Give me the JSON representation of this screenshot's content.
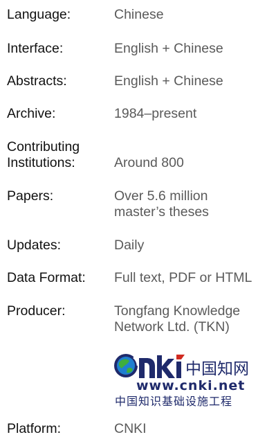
{
  "rows": [
    {
      "label": "Language:",
      "value": "Chinese"
    },
    {
      "label": "Interface:",
      "value": "English + Chinese"
    },
    {
      "label": "Abstracts:",
      "value": "English + Chinese"
    },
    {
      "label": "Archive:",
      "value": "1984–present"
    },
    {
      "label_line1": "Contributing",
      "label_line2": "Institutions:",
      "value": "Around 800"
    },
    {
      "label": "Papers:",
      "value_line1": "Over 5.6 million",
      "value_line2": "master’s theses"
    },
    {
      "label": "Updates:",
      "value": "Daily"
    },
    {
      "label": "Data Format:",
      "value": "Full text, PDF or HTML"
    },
    {
      "label": "Producer:",
      "value_line1": "Tongfang Knowledge",
      "value_line2": "Network Ltd. (TKN)"
    },
    {
      "label": "Platform:",
      "value": "CNKI"
    }
  ],
  "logo": {
    "brand": "CNKI",
    "chinese_title": "中国知网",
    "url": "www.cnki.net",
    "subtitle": "中国知识基础设施工程",
    "colors": {
      "navy": "#1f2a6b",
      "globe_blue": "#1f7fd0",
      "globe_green": "#3fae3c"
    }
  }
}
